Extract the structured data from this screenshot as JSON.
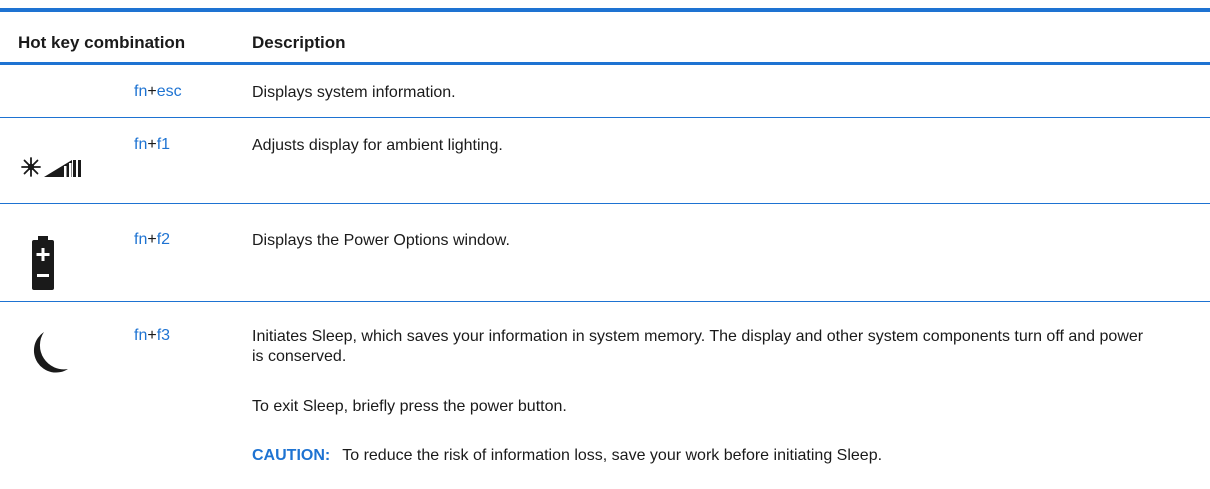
{
  "table": {
    "headers": {
      "combo": "Hot key combination",
      "description": "Description"
    },
    "rows": [
      {
        "icon": "none",
        "key1": "fn",
        "plus": "+",
        "key2": "esc",
        "description": "Displays system information."
      },
      {
        "icon": "ambient-light-brightness-icon",
        "key1": "fn",
        "plus": "+",
        "key2": "f1",
        "description": "Adjusts display for ambient lighting."
      },
      {
        "icon": "battery-power-icon",
        "key1": "fn",
        "plus": "+",
        "key2": "f2",
        "description": "Displays the Power Options window."
      },
      {
        "icon": "sleep-moon-icon",
        "key1": "fn",
        "plus": "+",
        "key2": "f3",
        "description": "Initiates Sleep, which saves your information in system memory. The display and other system components turn off and power is conserved.",
        "description_2": "To exit Sleep, briefly press the power button.",
        "caution_label": "CAUTION:",
        "caution_text": "To reduce the risk of information loss, save your work before initiating Sleep."
      }
    ]
  },
  "colors": {
    "accent": "#1e73d2",
    "text": "#1a1a1a"
  }
}
